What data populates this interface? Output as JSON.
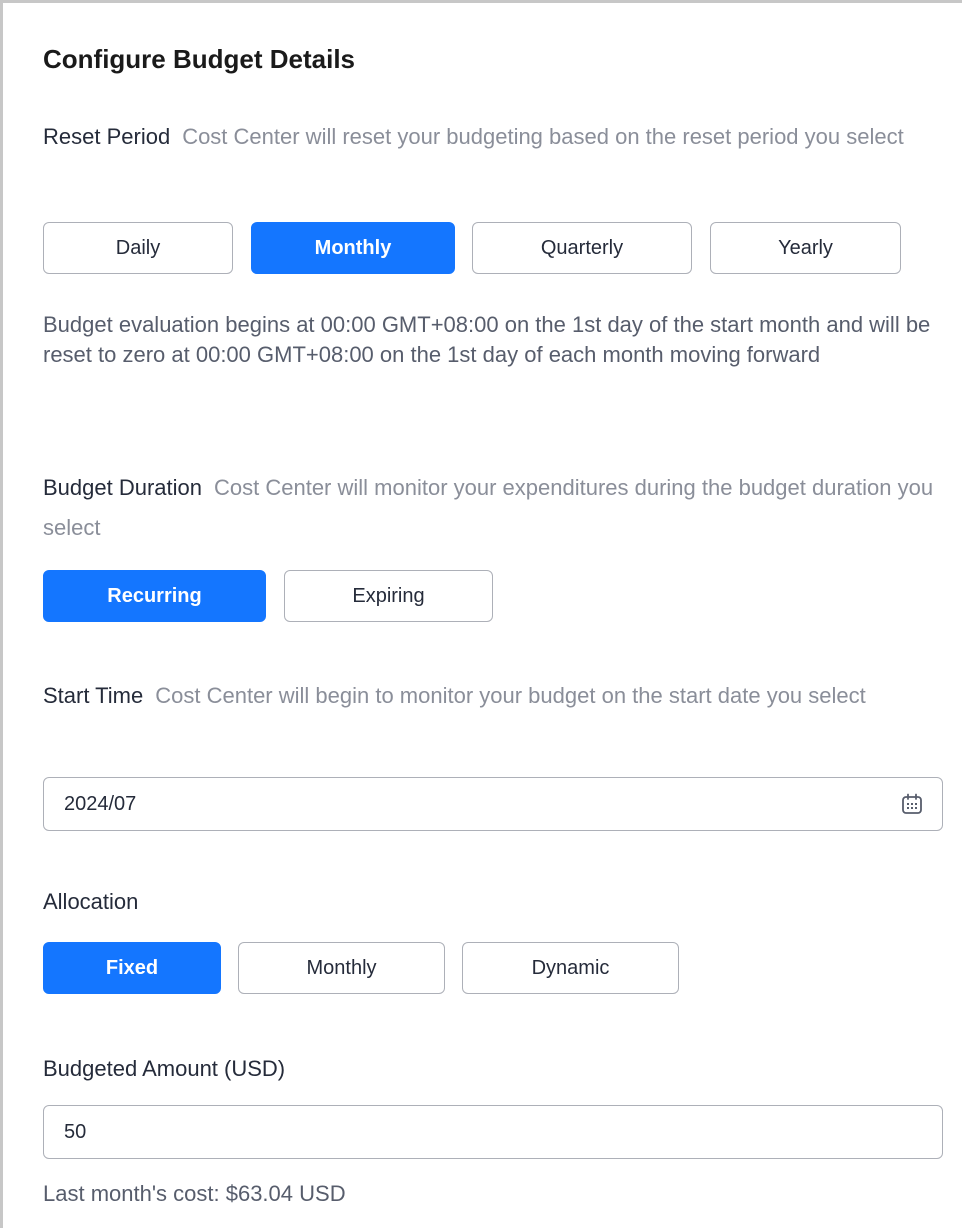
{
  "panel": {
    "title": "Configure Budget Details"
  },
  "reset_period": {
    "label": "Reset Period",
    "hint": "Cost Center will reset your budgeting based on the reset period you select",
    "options": [
      "Daily",
      "Monthly",
      "Quarterly",
      "Yearly"
    ],
    "selected": "Monthly",
    "description": "Budget evaluation begins at 00:00 GMT+08:00 on the 1st day of the start month and will be reset to zero at 00:00 GMT+08:00 on the 1st day of each month moving forward"
  },
  "budget_duration": {
    "label": "Budget Duration",
    "hint": "Cost Center will monitor your expenditures during the budget duration you select",
    "options": [
      "Recurring",
      "Expiring"
    ],
    "selected": "Recurring"
  },
  "start_time": {
    "label": "Start Time",
    "hint": "Cost Center will begin to monitor your budget on the start date you select",
    "value": "2024/07",
    "icon": "calendar-icon"
  },
  "allocation": {
    "label": "Allocation",
    "options": [
      "Fixed",
      "Monthly",
      "Dynamic"
    ],
    "selected": "Fixed"
  },
  "budgeted_amount": {
    "label": "Budgeted Amount (USD)",
    "value": "50",
    "last_month_cost": "Last month's cost: $63.04 USD"
  },
  "colors": {
    "accent": "#1476ff",
    "hint_text": "#8a8e99",
    "border": "#adb0b8",
    "frame": "#c7c7c7"
  }
}
